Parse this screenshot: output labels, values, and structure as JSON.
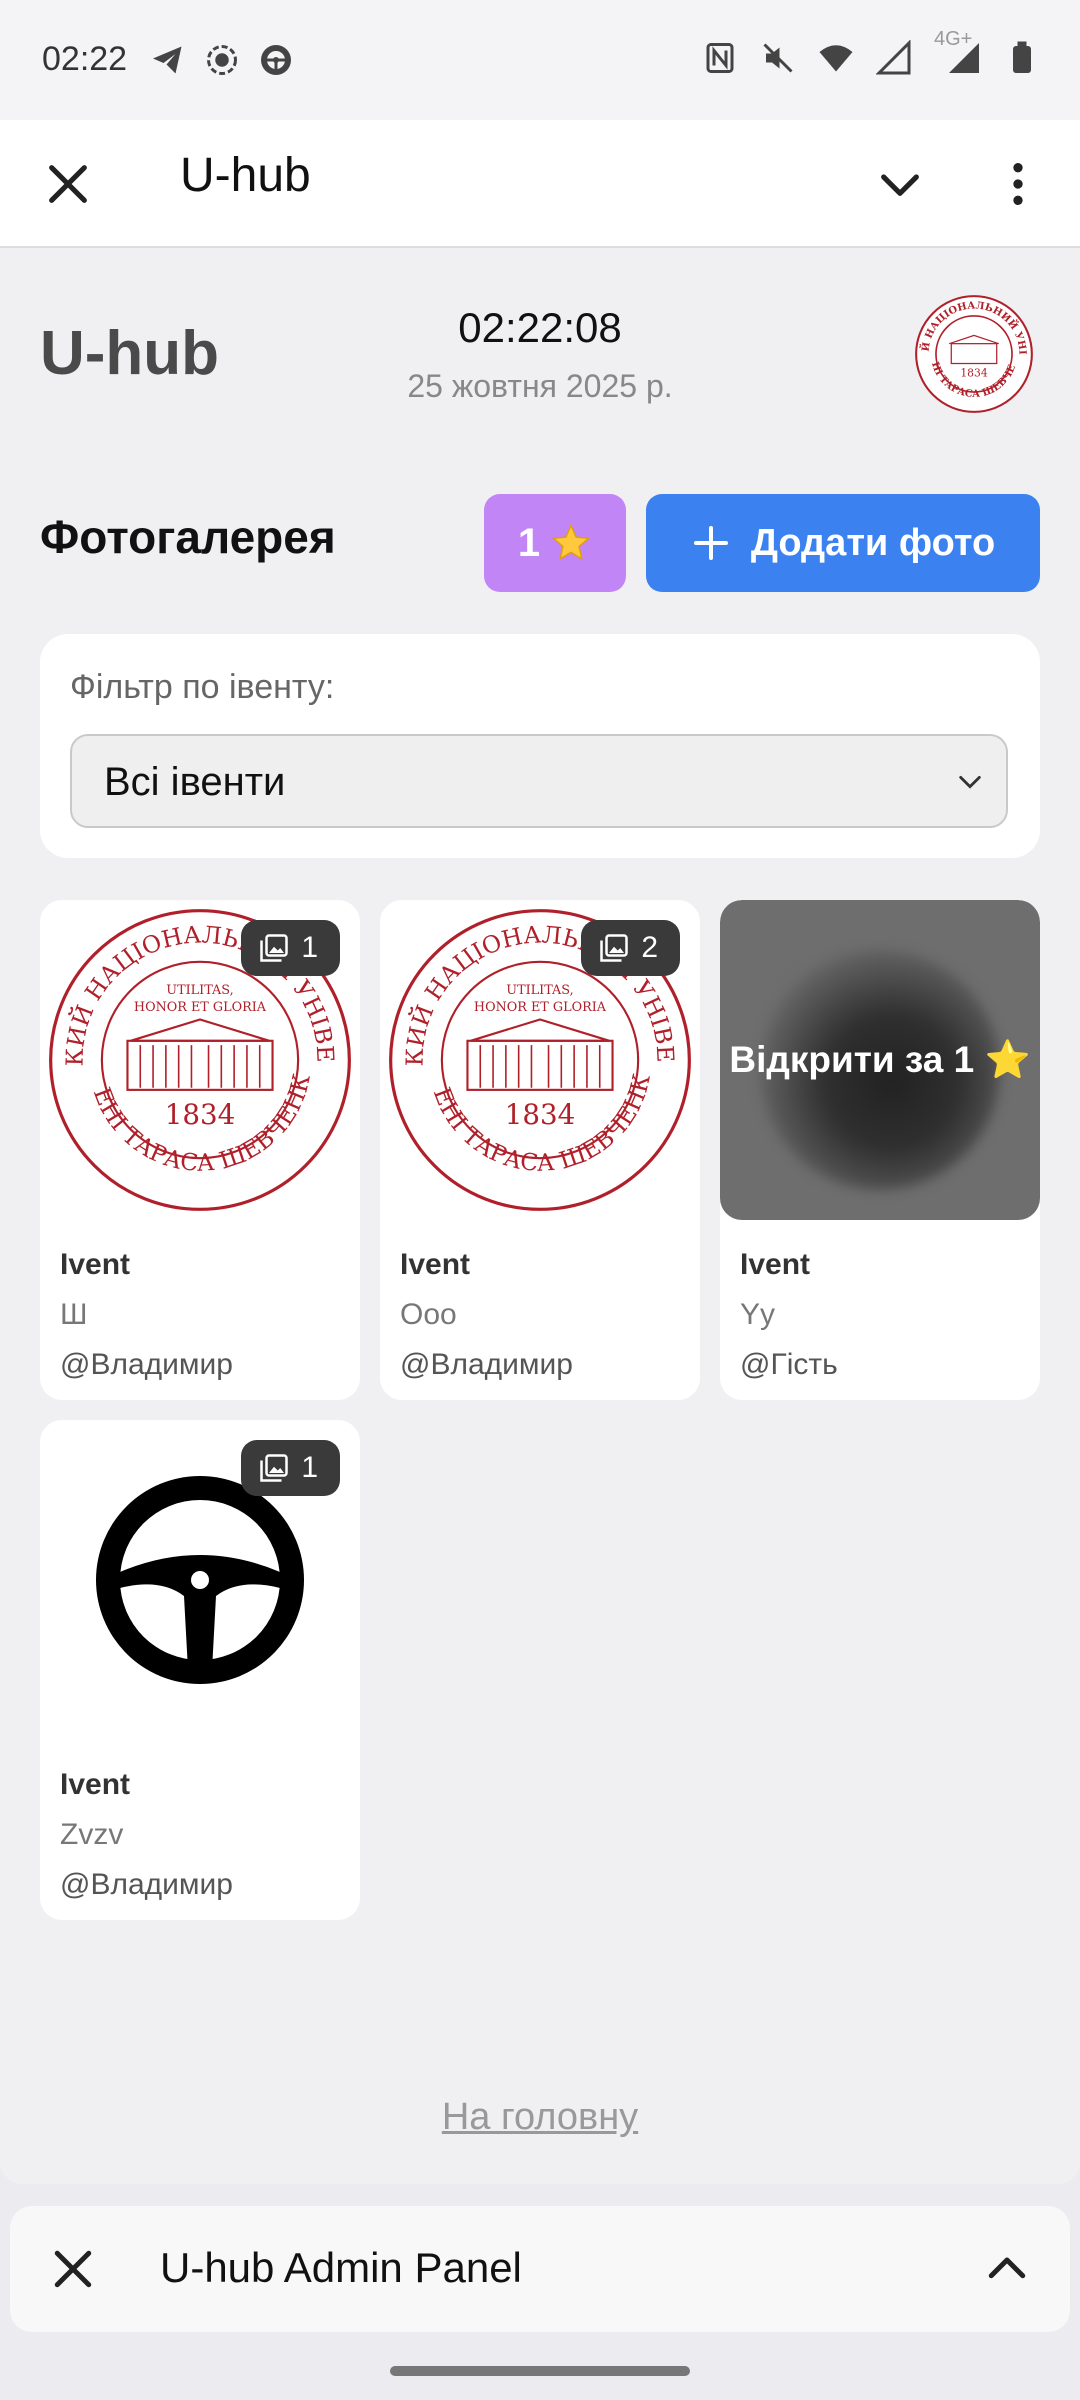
{
  "status_bar": {
    "time": "02:22",
    "left_icons": [
      "telegram-icon",
      "record-icon",
      "steering-wheel-icon"
    ],
    "right_icons": [
      "nfc-icon",
      "mute-icon",
      "wifi-icon",
      "signal-icon",
      "signal-4g-icon",
      "battery-icon"
    ],
    "network_label": "4G+"
  },
  "app_bar": {
    "title": "U-hub"
  },
  "header": {
    "brand": "U-hub",
    "clock": "02:22:08",
    "date": "25 жовтня 2025 р."
  },
  "gallery": {
    "title": "Фотогалерея",
    "stars_button_label": "1",
    "add_button_label": "Додати фото"
  },
  "filter": {
    "label": "Фільтр по івенту:",
    "selected": "Всі івенти"
  },
  "cards": [
    {
      "event": "Ivent",
      "caption": "Ш",
      "author": "@Владимир",
      "count": "1",
      "image": "university-seal"
    },
    {
      "event": "Ivent",
      "caption": "Ооо",
      "author": "@Владимир",
      "count": "2",
      "image": "university-seal"
    },
    {
      "event": "Ivent",
      "caption": "Yy",
      "author": "@Гість",
      "locked_label": "Відкрити за 1 ⭐",
      "image": "blurred"
    },
    {
      "event": "Ivent",
      "caption": "Zvzv",
      "author": "@Владимир",
      "count": "1",
      "image": "steering-wheel"
    }
  ],
  "seal": {
    "top_text": "КИЇВСЬКИЙ НАЦІОНАЛЬНИЙ УНІВЕРСИТЕТ",
    "bottom_text": "ІМЕНІ ТАРАСА ШЕВЧЕНКА",
    "motto_1": "UTILITAS,",
    "motto_2": "HONOR ET GLORIA",
    "year": "1834"
  },
  "footer": {
    "home_link": "На головну"
  },
  "bottom_panel": {
    "title": "U-hub Admin Panel"
  },
  "colors": {
    "stars_button": "#c285f6",
    "add_button": "#3b82f0",
    "seal_red": "#b0202a"
  }
}
